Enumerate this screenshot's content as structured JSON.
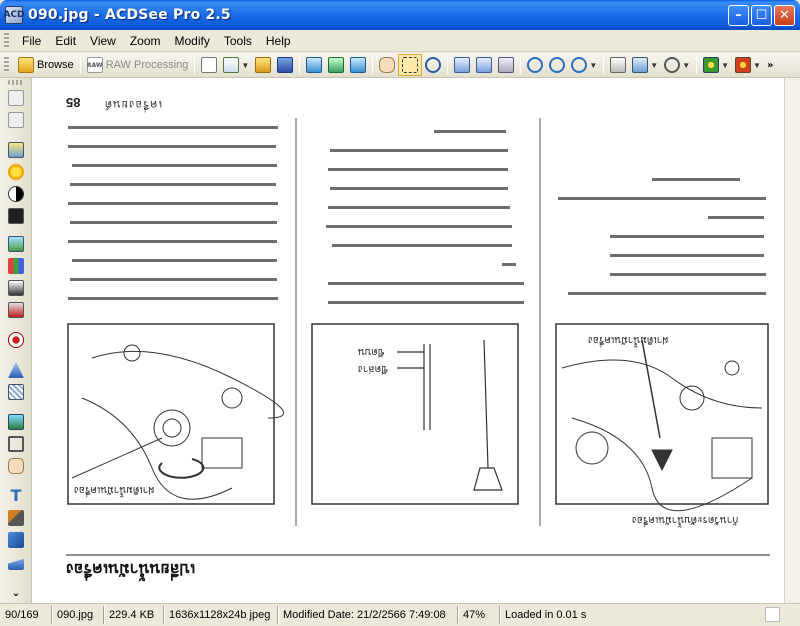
{
  "window": {
    "title": "090.jpg - ACDSee Pro 2.5",
    "app_icon": "acdsee-logo",
    "buttons": [
      "minimize-icon",
      "maximize-icon",
      "close-icon"
    ]
  },
  "menu": [
    "File",
    "Edit",
    "View",
    "Zoom",
    "Modify",
    "Tools",
    "Help"
  ],
  "toolbar": {
    "browse_label": "Browse",
    "raw_label": "RAW Processing",
    "raw_badge": "RAW"
  },
  "document": {
    "page_number": "85",
    "page_header": "เครื่องยนต์",
    "heading": "เปลี่ยนน้ำมันเครื่อง",
    "captions": {
      "fig1": "ฝาเติมน้ำมันเครื่อง",
      "fig2_a": "ขีดบน",
      "fig2_b": "ขีดล่าง",
      "fig3_top": "ฝาเติมน้ำมันเครื่อง",
      "fig3_bottom": "ก้านวัดระดับน้ำมันเครื่อง"
    }
  },
  "statusbar": {
    "position": "90/169",
    "filename": "090.jpg",
    "filesize": "229.4 KB",
    "dimensions": "1636x1128x24b jpeg",
    "modified": "Modified Date: 21/2/2566 7:49:08",
    "zoom": "47%",
    "load_time": "Loaded in 0.01 s"
  }
}
